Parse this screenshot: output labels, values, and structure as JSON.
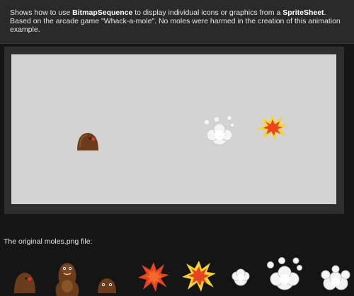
{
  "description": {
    "part1": "Shows how to use ",
    "class1": "BitmapSequence",
    "part2": " to display individual icons or graphics from a ",
    "class2": "SpriteSheet",
    "part3": ". Based on the arcade game \"Whack-a-mole\". No moles were harmed in the creation of this animation example."
  },
  "caption": "The original moles.png file:",
  "stage": {
    "background": "#d3d3d3",
    "sprites": [
      "mole-icon",
      "smoke-puff-icon",
      "explosion-icon"
    ]
  },
  "spritesheet": {
    "frames": [
      "mole-small-icon",
      "mole-standing-icon",
      "mole-peeking-icon",
      "explosion-red-icon",
      "explosion-yellow-icon",
      "smoke-small-icon",
      "smoke-large-icon",
      "smoke-cluster-icon"
    ]
  },
  "colors": {
    "mole": "#6b3c1c",
    "explosion_red": "#e8451e",
    "explosion_yellow": "#f6d431",
    "smoke": "#f4f4f4"
  }
}
